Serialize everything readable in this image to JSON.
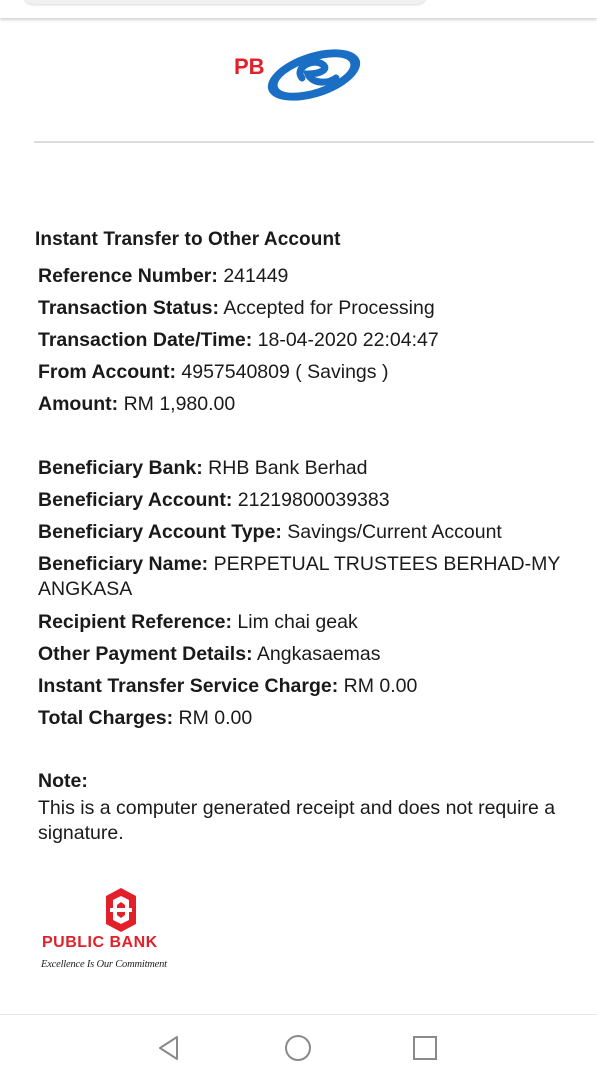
{
  "header": {
    "logo_text": "PBe"
  },
  "receipt": {
    "title": "Instant Transfer to Other Account",
    "reference_number": {
      "label": "Reference Number:",
      "value": "241449"
    },
    "transaction_status": {
      "label": "Transaction Status:",
      "value": "Accepted for Processing"
    },
    "transaction_datetime": {
      "label": "Transaction Date/Time:",
      "value": "18-04-2020 22:04:47"
    },
    "from_account": {
      "label": "From Account:",
      "value": "4957540809 ( Savings )"
    },
    "amount": {
      "label": "Amount:",
      "value": "RM 1,980.00"
    },
    "beneficiary_bank": {
      "label": "Beneficiary Bank:",
      "value": "RHB Bank Berhad"
    },
    "beneficiary_account": {
      "label": "Beneficiary Account:",
      "value": "21219800039383"
    },
    "beneficiary_account_type": {
      "label": "Beneficiary Account Type:",
      "value": "Savings/Current Account"
    },
    "beneficiary_name": {
      "label": "Beneficiary Name:",
      "value": "PERPETUAL TRUSTEES BERHAD-MY ANGKASA"
    },
    "recipient_reference": {
      "label": "Recipient Reference:",
      "value": "Lim chai geak"
    },
    "other_payment_details": {
      "label": "Other Payment Details:",
      "value": "Angkasaemas"
    },
    "service_charge": {
      "label": "Instant Transfer Service Charge:",
      "value": "RM 0.00"
    },
    "total_charges": {
      "label": "Total Charges:",
      "value": "RM 0.00"
    },
    "note_label": "Note:",
    "note_text": "This is a computer generated receipt and does not require a signature."
  },
  "footer": {
    "brand": "PUBLIC BANK",
    "tagline": "Excellence Is Our Commitment"
  },
  "nav": {
    "back": "back-icon",
    "home": "home-icon",
    "recents": "recents-icon"
  },
  "colors": {
    "brand_red": "#e1202a",
    "brand_blue": "#1a6fc4"
  }
}
